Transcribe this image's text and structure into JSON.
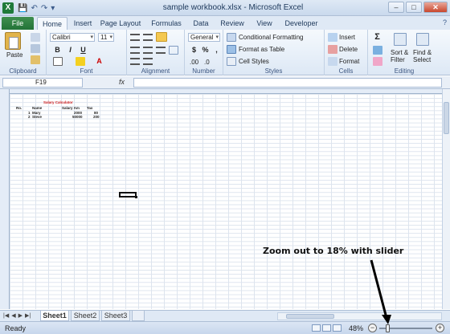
{
  "window": {
    "title": "sample workbook.xlsx - Microsoft Excel",
    "app_icon": "X",
    "minimize": "–",
    "maximize": "□",
    "close": "✕"
  },
  "qat": {
    "save": "💾",
    "undo": "↶",
    "redo": "↷",
    "customize": "▾"
  },
  "tabs": {
    "file": "File",
    "items": [
      "Home",
      "Insert",
      "Page Layout",
      "Formulas",
      "Data",
      "Review",
      "View",
      "Developer"
    ],
    "active": "Home",
    "help": "?"
  },
  "ribbon": {
    "clipboard": {
      "label": "Clipboard",
      "paste": "Paste"
    },
    "font": {
      "label": "Font",
      "name": "Calibri",
      "size": "11",
      "grow": "A",
      "shrink": "A",
      "bold": "B",
      "italic": "I",
      "underline": "U"
    },
    "alignment": {
      "label": "Alignment"
    },
    "number": {
      "label": "Number",
      "format": "General",
      "currency": "$",
      "percent": "%",
      "comma": ",",
      "inc": ".00",
      "dec": ".0"
    },
    "styles": {
      "label": "Styles",
      "conditional": "Conditional Formatting",
      "table": "Format as Table",
      "cell_styles": "Cell Styles"
    },
    "cells": {
      "label": "Cells",
      "insert": "Insert",
      "delete": "Delete",
      "format": "Format"
    },
    "editing": {
      "label": "Editing",
      "sigma": "Σ",
      "sort": "Sort &",
      "filter": "Filter",
      "find": "Find &",
      "select": "Select"
    }
  },
  "formula_bar": {
    "name_box": "F19",
    "fx": "fx",
    "value": ""
  },
  "sheet_cells": {
    "title": "Salary Calculator",
    "headers": [
      "Ro.",
      "Name",
      "Salary Am",
      "Tax"
    ],
    "rows": [
      [
        "1",
        "Mary",
        "2000",
        "80"
      ],
      [
        "2",
        "Steve",
        "50000",
        "200"
      ]
    ]
  },
  "sheets": {
    "items": [
      "Sheet1",
      "Sheet2",
      "Sheet3"
    ],
    "active": "Sheet1"
  },
  "status": {
    "ready": "Ready",
    "zoom": "48%",
    "minus": "−",
    "plus": "+",
    "zoom_level": 0.48
  },
  "annotation": {
    "text": "Zoom out to 18% with slider"
  },
  "colors": {
    "file_tab": "#237338",
    "accent": "#1e395b",
    "title_red": "#d02020",
    "grid": "#dde4ee"
  }
}
